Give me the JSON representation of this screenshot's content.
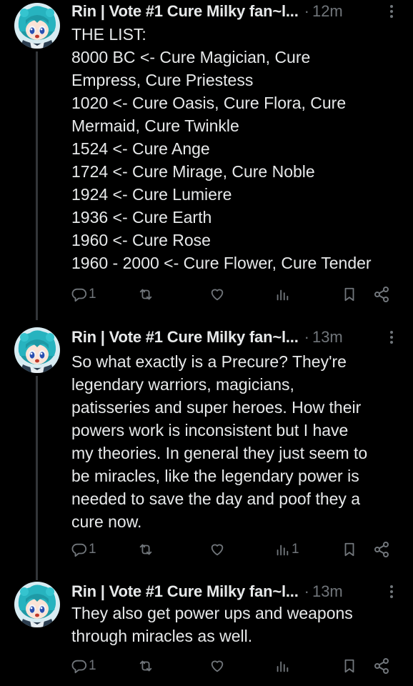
{
  "colors": {
    "background": "#000000",
    "text": "#e7e9ea",
    "secondary": "#71767b",
    "thread_line": "#333639"
  },
  "tweets": [
    {
      "author": "Rin | Vote #1 Cure Milky fan~l...",
      "separator": "·",
      "time": "12m",
      "lines": [
        "THE LIST:",
        "8000 BC <- Cure Magician, Cure",
        "Empress, Cure Priestess",
        "1020 <- Cure Oasis, Cure Flora, Cure",
        "Mermaid, Cure Twinkle",
        "1524 <- Cure Ange",
        "1724 <- Cure Mirage, Cure Noble",
        "1924 <- Cure Lumiere",
        "1936 <- Cure Earth",
        "1960 <- Cure Rose",
        "1960 - 2000 <- Cure Flower, Cure Tender"
      ],
      "reply_count": "1",
      "views_count": ""
    },
    {
      "author": "Rin | Vote #1 Cure Milky fan~l...",
      "separator": "·",
      "time": "13m",
      "lines": [
        "So what exactly is a Precure? They're",
        "legendary warriors, magicians,",
        "patisseries and super heroes. How their",
        "powers work is inconsistent but I have",
        "my theories. In general they just seem to",
        "be miracles, like the legendary power is",
        "needed to save the day and poof they a",
        "cure now."
      ],
      "reply_count": "1",
      "views_count": "1"
    },
    {
      "author": "Rin | Vote #1 Cure Milky fan~l...",
      "separator": "·",
      "time": "13m",
      "lines": [
        "They also get power ups and weapons",
        "through miracles as well."
      ],
      "reply_count": "1",
      "views_count": ""
    }
  ],
  "icons": {
    "more": "more-dots-icon",
    "reply": "reply-icon",
    "retweet": "retweet-icon",
    "like": "heart-icon",
    "views": "views-chart-icon",
    "bookmark": "bookmark-icon",
    "share": "share-icon"
  }
}
